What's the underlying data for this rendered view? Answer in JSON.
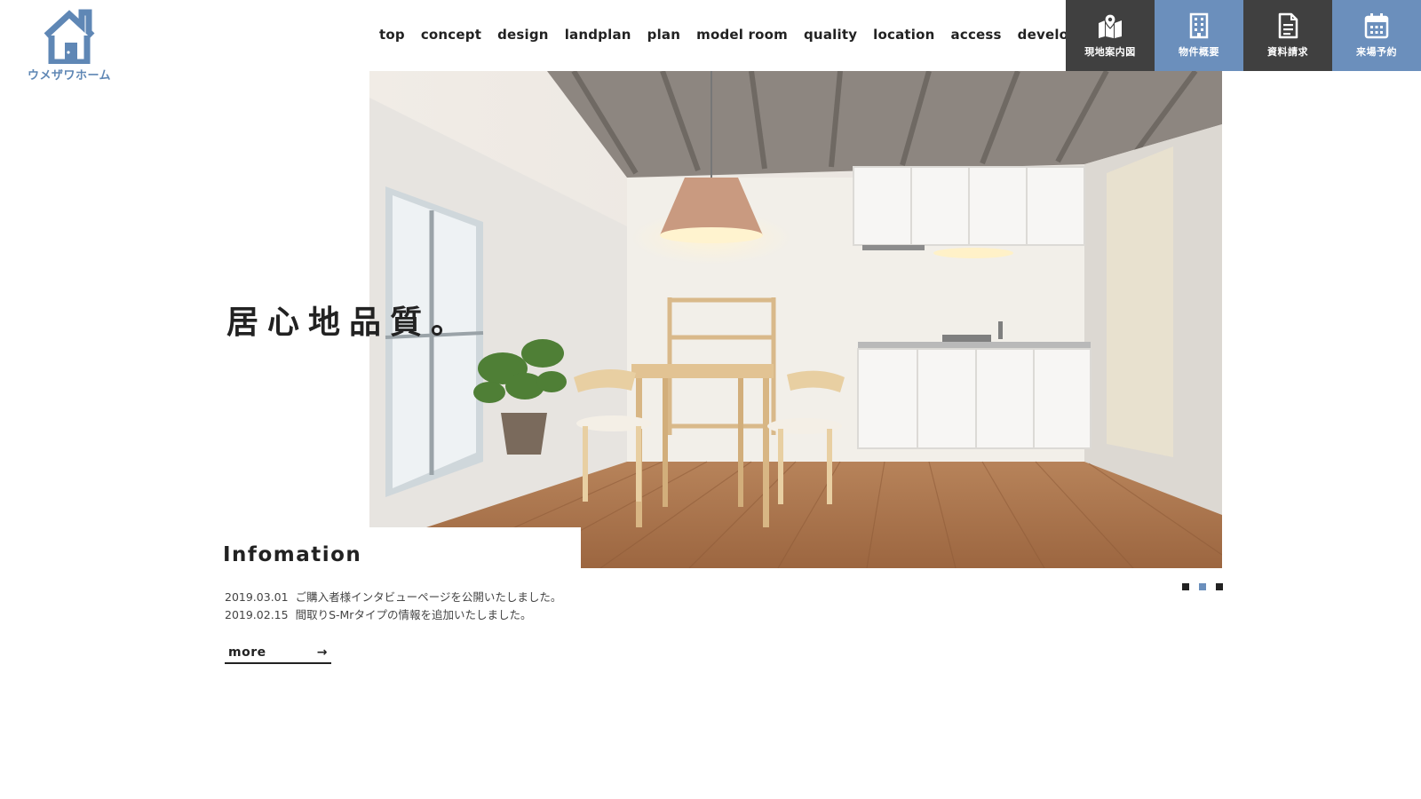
{
  "brand": {
    "name": "ウメザワホーム",
    "color": "#5f87b5"
  },
  "nav": {
    "items": [
      {
        "label": "top"
      },
      {
        "label": "concept"
      },
      {
        "label": "design"
      },
      {
        "label": "landplan"
      },
      {
        "label": "plan"
      },
      {
        "label": "model room"
      },
      {
        "label": "quality"
      },
      {
        "label": "location"
      },
      {
        "label": "access"
      },
      {
        "label": "developers"
      }
    ]
  },
  "actions": [
    {
      "label": "現地案内図",
      "icon": "map-pin-icon",
      "color": "#404040"
    },
    {
      "label": "物件概要",
      "icon": "building-icon",
      "color": "#6b8fbc"
    },
    {
      "label": "資料請求",
      "icon": "document-icon",
      "color": "#404040"
    },
    {
      "label": "来場予約",
      "icon": "calendar-icon",
      "color": "#6b8fbc"
    }
  ],
  "hero": {
    "catchcopy": "居心地品質。",
    "image": "interior-photo"
  },
  "info": {
    "title": "Infomation",
    "news": [
      {
        "date": "2019.03.01",
        "text": "ご購入者様インタビューページを公開いたしました。"
      },
      {
        "date": "2019.02.15",
        "text": "間取りS-Mrタイプの情報を追加いたしました。"
      }
    ],
    "more_label": "more",
    "more_icon": "arrow-right-icon"
  },
  "slider": {
    "count": 3,
    "active": 2
  }
}
